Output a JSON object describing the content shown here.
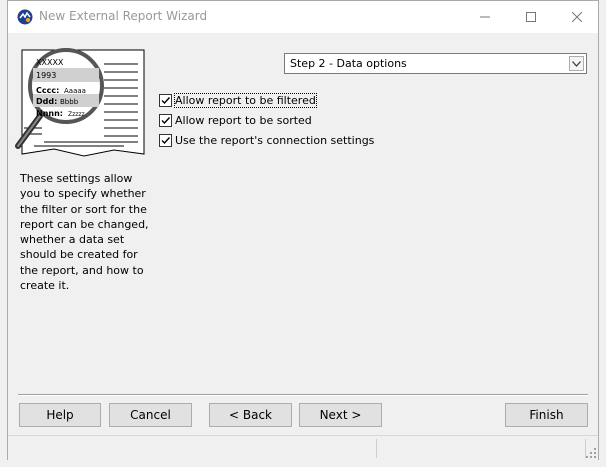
{
  "window": {
    "title": "New External Report Wizard",
    "minimize_glyph": "—",
    "maximize_glyph": "☐",
    "close_glyph": "✕"
  },
  "illustration": {
    "line1": "XXXXX",
    "line2": "1993",
    "field1_label": "Cccc:",
    "field1_value": "Aaaaa",
    "field2_label": "Ddd:",
    "field2_value": "Bbbb",
    "field3_label": "Nnnn:",
    "field3_value": "Zzzzz"
  },
  "description": "These settings allow you to specify whether the filter or sort for the report can be changed, whether a data set should be created for the report, and how to create it.",
  "step_select": {
    "value": "Step 2 - Data options"
  },
  "options": [
    {
      "label": "Allow report to be filtered",
      "checked": true
    },
    {
      "label": "Allow report to be sorted",
      "checked": true
    },
    {
      "label": "Use the report's connection settings",
      "checked": true
    }
  ],
  "buttons": {
    "help": "Help",
    "cancel": "Cancel",
    "back": "< Back",
    "next": "Next >",
    "finish": "Finish"
  },
  "colors": {
    "title_text": "#999999",
    "button_face": "#e1e1e1",
    "dialog_bg": "#f0f0f0"
  }
}
